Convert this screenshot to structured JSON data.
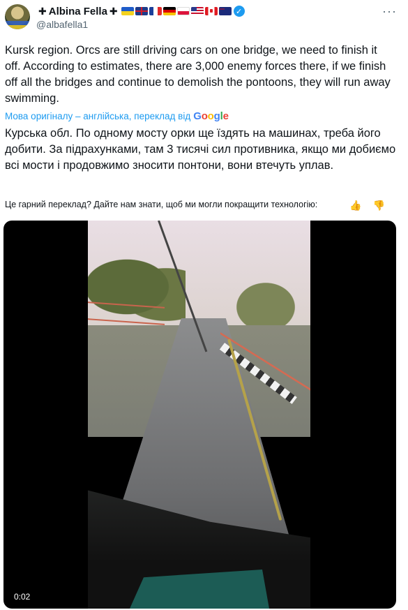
{
  "author": {
    "name": "Albina Fella",
    "prefix_symbol": "✚",
    "suffix_symbol": "✚",
    "handle": "@albafella1",
    "flags": [
      "ukraine-flag",
      "uk-flag",
      "france-flag",
      "germany-flag",
      "poland-flag",
      "usa-flag",
      "canada-flag",
      "australia-flag"
    ],
    "verified": "✓"
  },
  "more_menu": "···",
  "tweet": {
    "text": "Kursk region. Orcs are still driving cars on one bridge, we need to finish it off. According to estimates, there are 3,000 enemy forces there, if we finish off all the bridges and continue to demolish the pontoons, they will run away swimming."
  },
  "translation": {
    "label": "Мова оригіналу – англійська, переклад від",
    "provider": "Google",
    "text": "Курська обл. По одному мосту орки ще їздять на машинах, треба його добити. За підрахунками, там 3 тисячі сил противника, якщо ми добиємо всі мости і продовжимо зносити понтони, вони втечуть уплав.",
    "feedback_question": "Це гарний переклад? Дайте нам знати, щоб ми могли покращити технологію:",
    "thumbs_up": "👍",
    "thumbs_down": "👎"
  },
  "video": {
    "timestamp": "0:02"
  },
  "colors": {
    "link_blue": "#1d9bf0",
    "text": "#0f1419",
    "muted": "#536471"
  }
}
